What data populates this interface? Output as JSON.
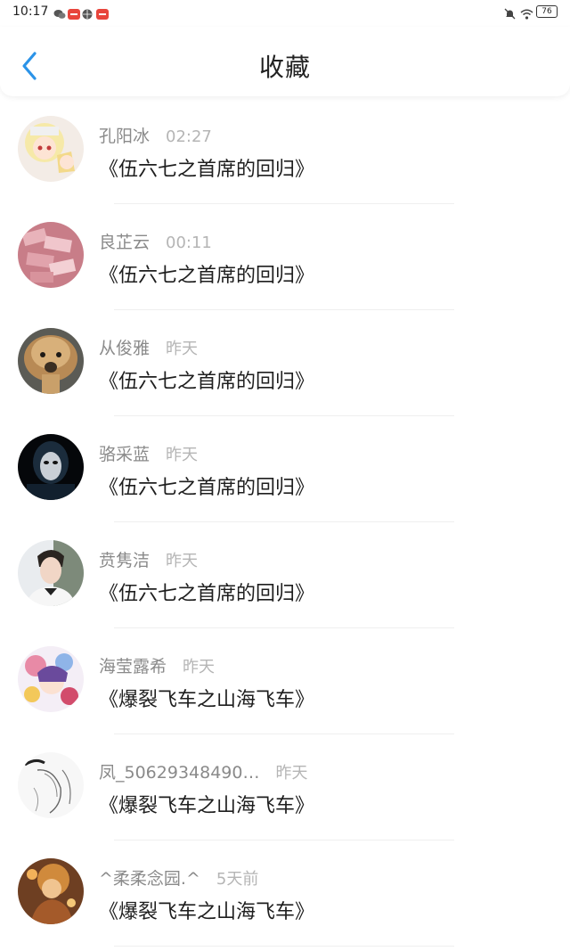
{
  "status_bar": {
    "time": "10:17",
    "battery": "76",
    "icons": [
      "wechat-icon",
      "app-icon",
      "basketball-icon",
      "app-icon",
      "bell-mute-icon",
      "wifi-icon",
      "battery-icon"
    ]
  },
  "header": {
    "title": "收藏",
    "back_icon": "chevron-left-icon"
  },
  "colors": {
    "accent": "#2b93e8",
    "title": "#222222",
    "name": "#8a8a8a",
    "time": "#b5b5b5",
    "content": "#1e1e1e"
  },
  "items": [
    {
      "name": "孔阳冰",
      "time": "02:27",
      "title": "《伍六七之首席的回归》",
      "avatar": "anime-girl-avatar"
    },
    {
      "name": "良芷云",
      "time": "00:11",
      "title": "《伍六七之首席的回归》",
      "avatar": "money-stack-avatar"
    },
    {
      "name": "从俊雅",
      "time": "昨天",
      "title": "《伍六七之首席的回归》",
      "avatar": "alpaca-avatar"
    },
    {
      "name": "骆采蓝",
      "time": "昨天",
      "title": "《伍六七之首席的回归》",
      "avatar": "mask-avatar"
    },
    {
      "name": "贲隽洁",
      "time": "昨天",
      "title": "《伍六七之首席的回归》",
      "avatar": "man-avatar"
    },
    {
      "name": "海莹露希",
      "time": "昨天",
      "title": "《爆裂飞车之山海飞车》",
      "avatar": "anime-colorful-avatar"
    },
    {
      "name": "凤_50629348490…",
      "time": "昨天",
      "title": "《爆裂飞车之山海飞车》",
      "avatar": "sketch-avatar"
    },
    {
      "name": "^柔柔念园.^",
      "time": "5天前",
      "title": "《爆裂飞车之山海飞车》",
      "avatar": "warm-art-avatar"
    }
  ]
}
